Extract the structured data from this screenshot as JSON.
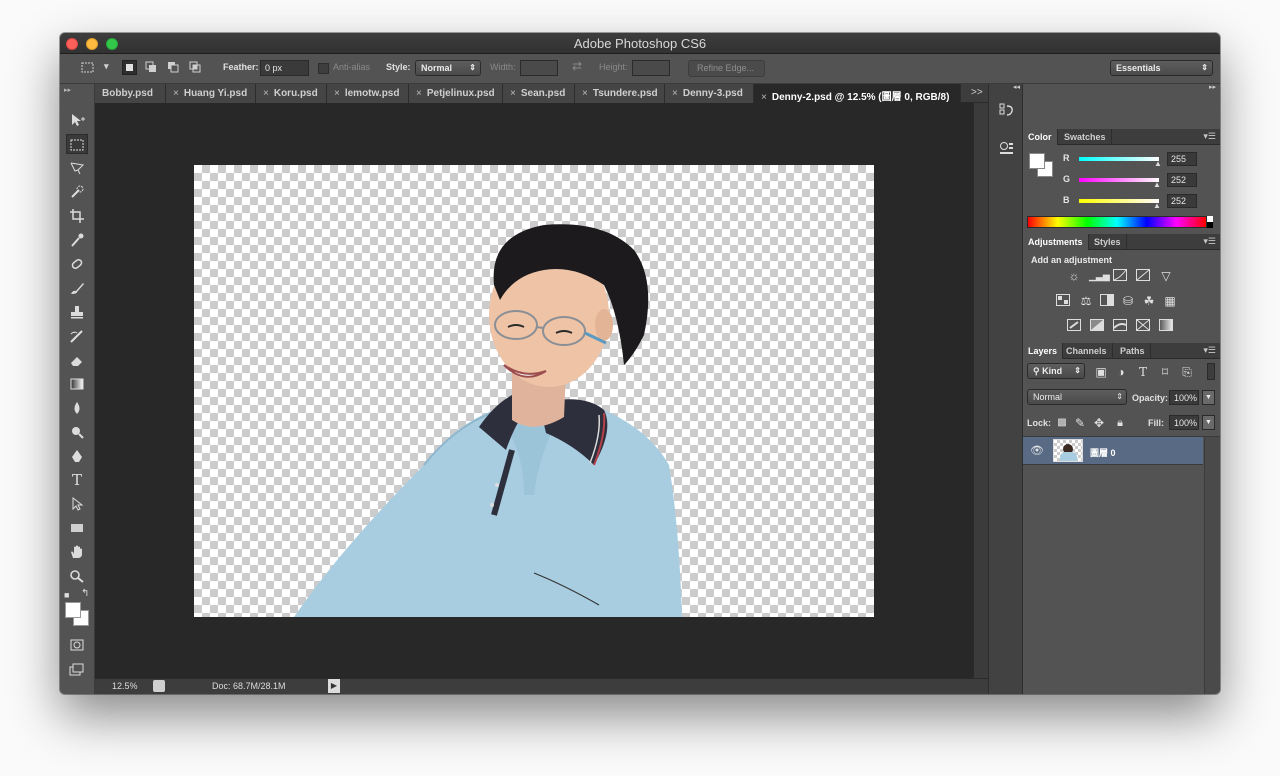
{
  "window": {
    "title": "Adobe Photoshop CS6"
  },
  "options_bar": {
    "feather_label": "Feather:",
    "feather_value": "0 px",
    "antialias_label": "Anti-alias",
    "style_label": "Style:",
    "style_value": "Normal",
    "width_label": "Width:",
    "height_label": "Height:",
    "refine_edge": "Refine Edge...",
    "workspace": "Essentials"
  },
  "tabs": [
    {
      "label": "Bobby.psd"
    },
    {
      "label": "Huang Yi.psd"
    },
    {
      "label": "Koru.psd"
    },
    {
      "label": "lemotw.psd"
    },
    {
      "label": "Petjelinux.psd"
    },
    {
      "label": "Sean.psd"
    },
    {
      "label": "Tsundere.psd"
    },
    {
      "label": "Denny-3.psd"
    },
    {
      "label": "Denny-2.psd @ 12.5% (圖層 0, RGB/8)"
    }
  ],
  "tabs_overflow": ">>",
  "tab_close": "×",
  "status": {
    "zoom": "12.5%",
    "doc": "Doc: 68.7M/28.1M"
  },
  "color_panel": {
    "tabs": [
      "Color",
      "Swatches"
    ],
    "channels": [
      {
        "name": "R",
        "value": "255"
      },
      {
        "name": "G",
        "value": "252"
      },
      {
        "name": "B",
        "value": "252"
      }
    ]
  },
  "adjustments_panel": {
    "tabs": [
      "Adjustments",
      "Styles"
    ],
    "heading": "Add an adjustment"
  },
  "layers_panel": {
    "tabs": [
      "Layers",
      "Channels",
      "Paths"
    ],
    "filter": "Kind",
    "blend_mode": "Normal",
    "opacity_label": "Opacity:",
    "opacity_value": "100%",
    "lock_label": "Lock:",
    "fill_label": "Fill:",
    "fill_value": "100%",
    "layers": [
      {
        "name": "圖層 0"
      }
    ]
  },
  "colors": {
    "accent_selection": "#586a84",
    "ui_bg": "#535353",
    "canvas_bg": "#282828"
  }
}
